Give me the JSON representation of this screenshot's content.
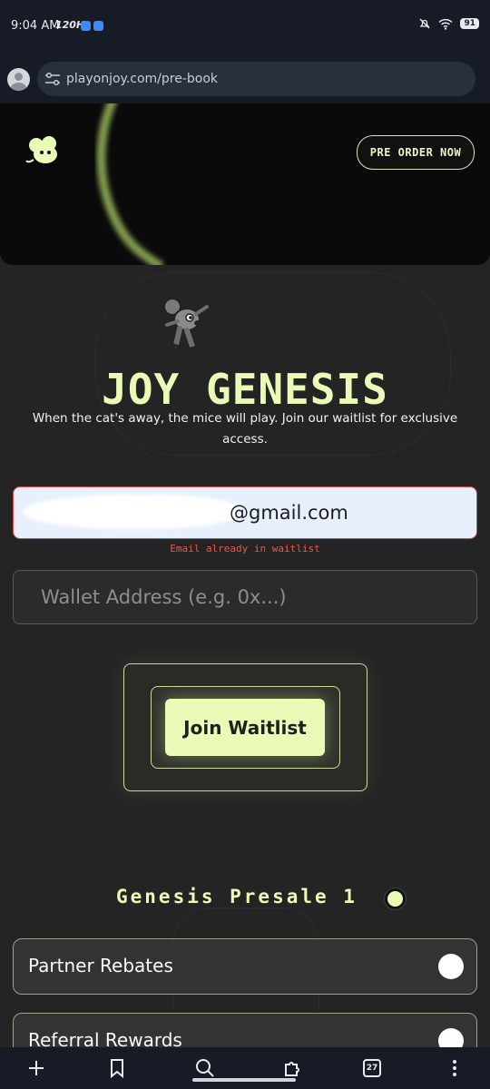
{
  "status_bar": {
    "time": "9:04 AM",
    "rate": "120Hz",
    "battery": "91"
  },
  "browser": {
    "url": "playonjoy.com/pre-book"
  },
  "header": {
    "preorder_label": "PRE ORDER NOW"
  },
  "hero": {
    "title": "JOY GENESIS",
    "subtitle": "When the cat's away, the mice will play. Join our waitlist for exclusive access."
  },
  "form": {
    "email_value": "@gmail.com",
    "email_error": "Email already in waitlist",
    "wallet_placeholder": "Wallet Address (e.g. 0x...)",
    "join_label": "Join Waitlist"
  },
  "presale": {
    "label": "Genesis Presale 1",
    "features": [
      "Partner Rebates",
      "Referral Rewards"
    ]
  },
  "bottom_nav": {
    "tabs_count": "27"
  },
  "colors": {
    "accent": "#e9fbb6",
    "error": "#d94b4b",
    "background": "#242424"
  }
}
